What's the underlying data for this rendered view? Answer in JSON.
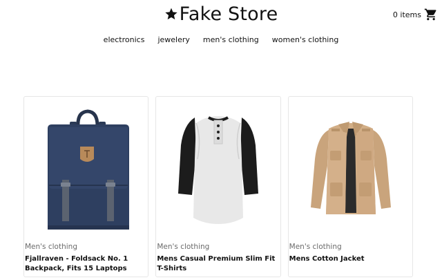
{
  "brand": {
    "name": "Fake Store",
    "icon": "star-icon"
  },
  "cart": {
    "label": "0 items",
    "icon": "shopping-cart-icon"
  },
  "nav": {
    "categories": [
      "electronics",
      "jewelery",
      "men's clothing",
      "women's clothing"
    ]
  },
  "products": [
    {
      "category": "Men's clothing",
      "title": "Fjallraven - Foldsack No. 1 Backpack, Fits 15 Laptops",
      "image": "backpack"
    },
    {
      "category": "Men's clothing",
      "title": "Mens Casual Premium Slim Fit T-Shirts",
      "image": "raglan-tshirt"
    },
    {
      "category": "Men's clothing",
      "title": "Mens Cotton Jacket",
      "image": "cotton-jacket"
    }
  ]
}
